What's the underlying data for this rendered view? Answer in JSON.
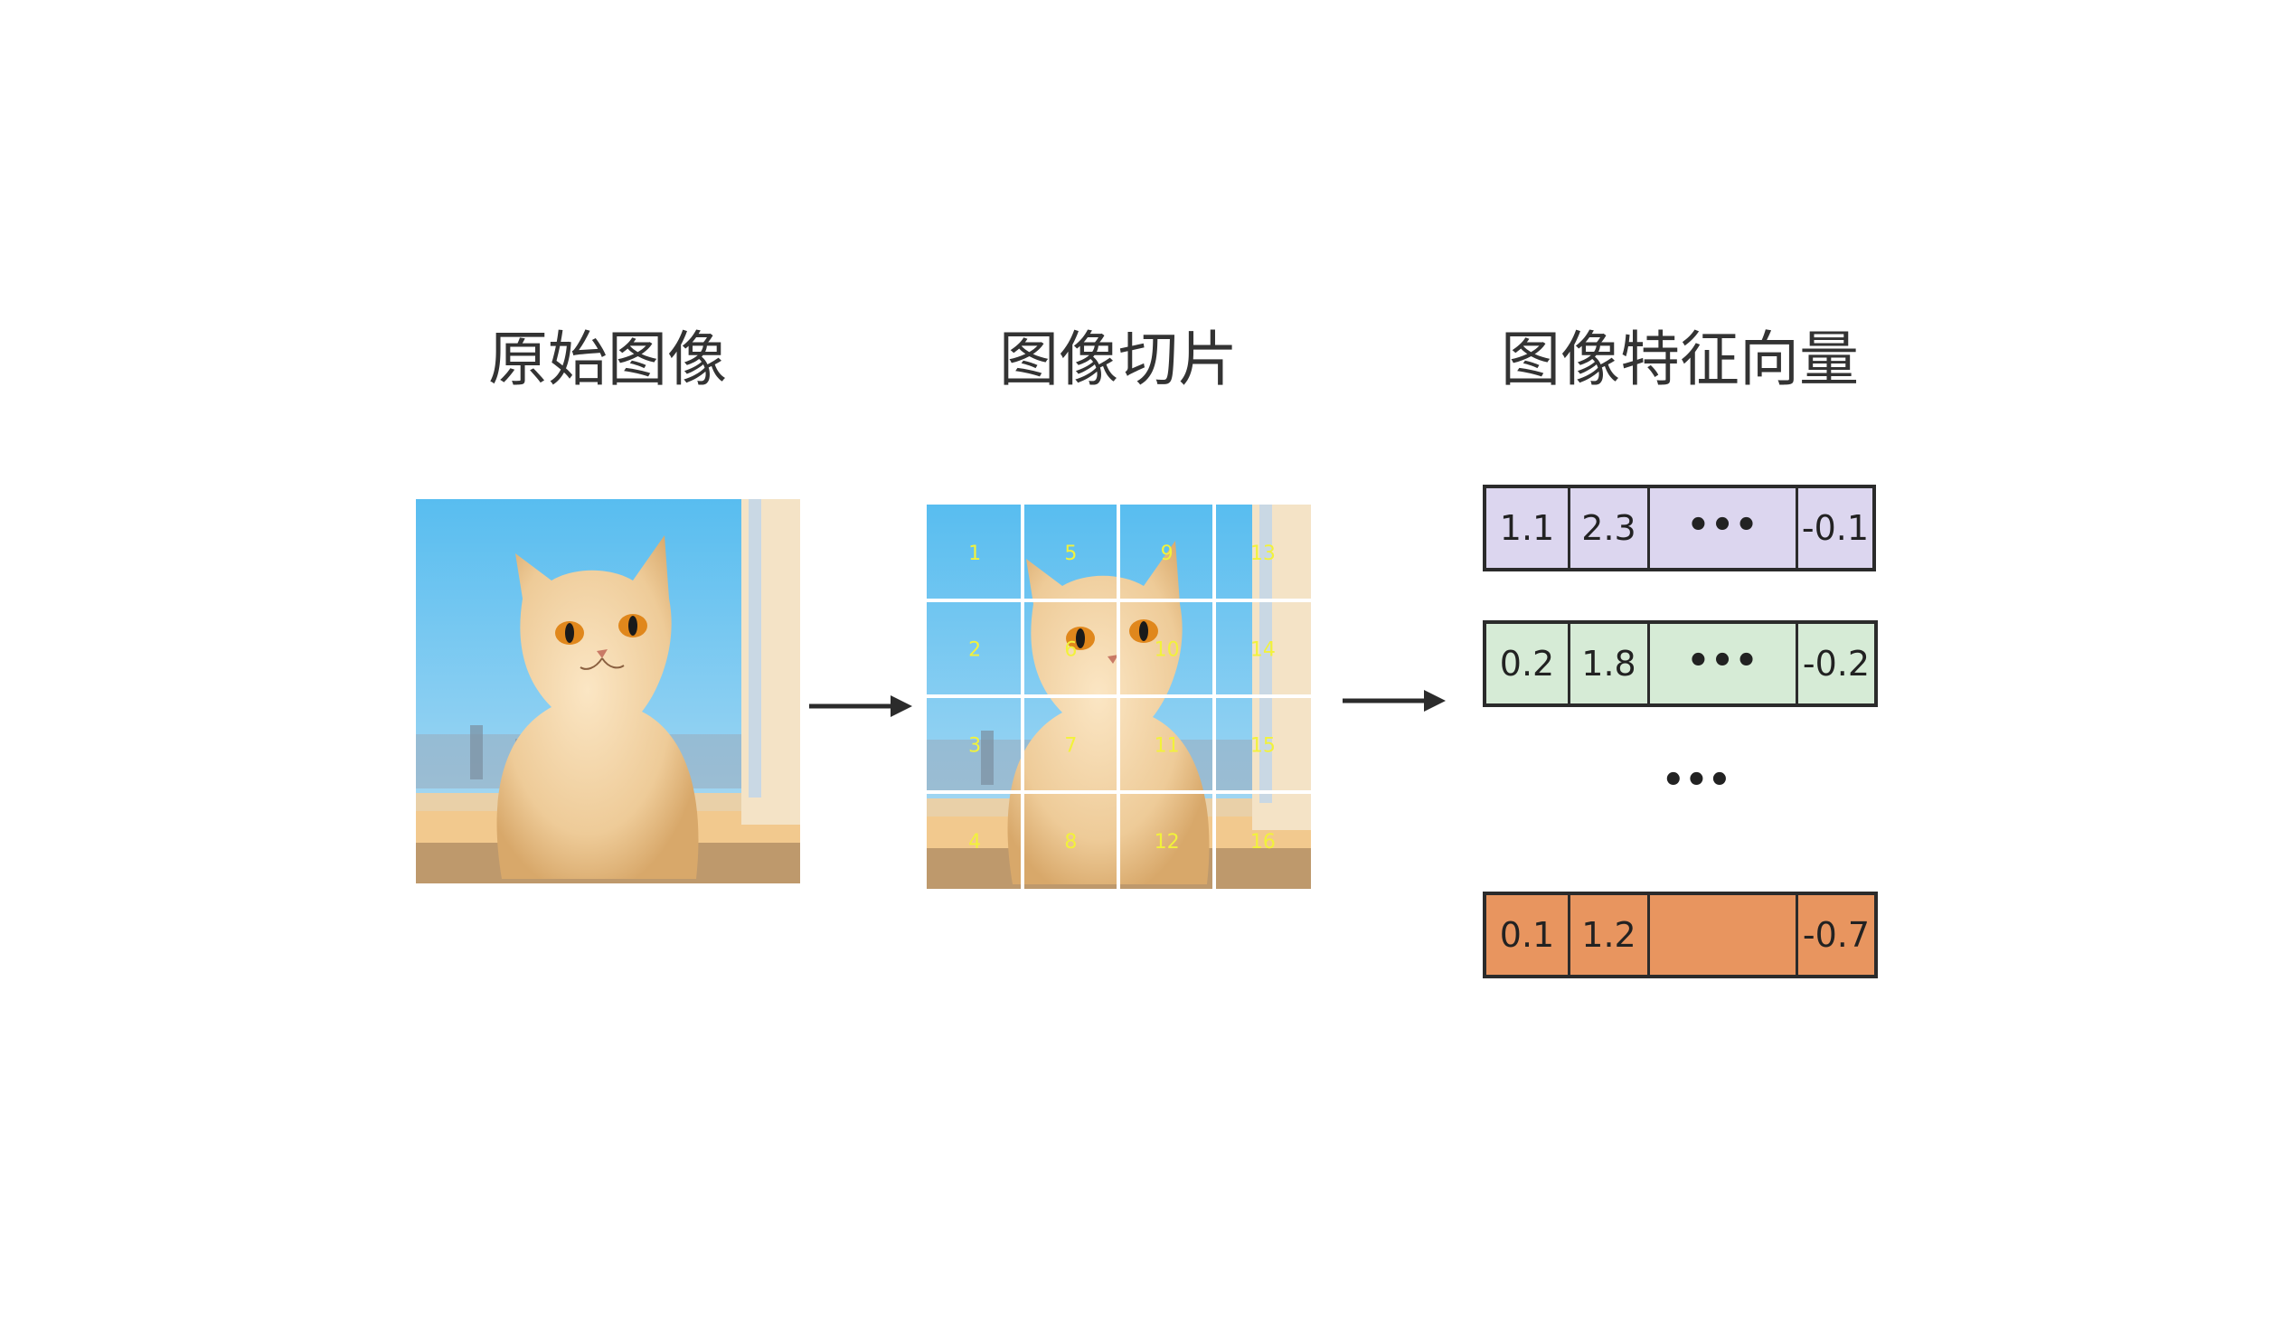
{
  "titles": {
    "original": "原始图像",
    "patches": "图像切片",
    "vectors": "图像特征向量"
  },
  "patch_numbers": [
    "1",
    "2",
    "3",
    "4",
    "5",
    "6",
    "7",
    "8",
    "9",
    "10",
    "11",
    "12",
    "13",
    "14",
    "15",
    "16"
  ],
  "vectors": {
    "row1": [
      "1.1",
      "2.3",
      "•••",
      "-0.1"
    ],
    "row2": [
      "0.2",
      "1.8",
      "•••",
      "-0.2"
    ],
    "gap": "•••",
    "row3": [
      "0.1",
      "1.2",
      "",
      "-0.7"
    ]
  },
  "colors": {
    "row1": "#dcd6ef",
    "row2": "#d6ebd6",
    "row3": "#e8955f",
    "patch_number": "#f2f23a"
  }
}
